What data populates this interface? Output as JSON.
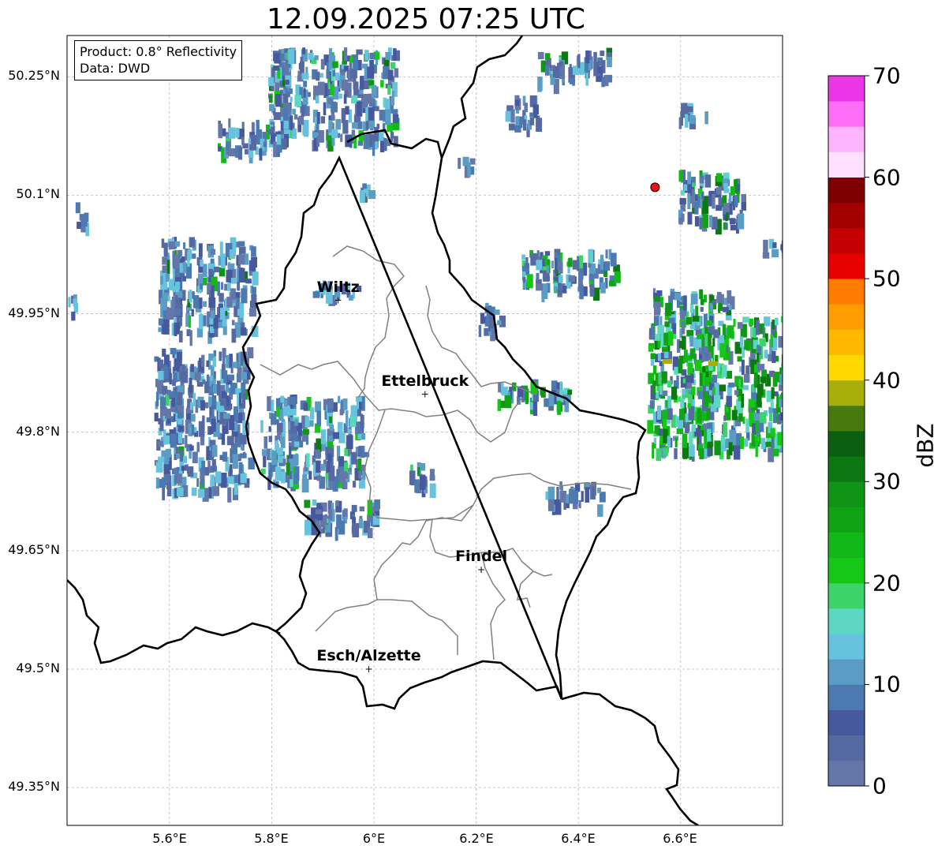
{
  "title": "12.09.2025 07:25 UTC",
  "info_box": {
    "product": "Product: 0.8° Reflectivity",
    "data": "Data: DWD"
  },
  "latitude_ticks": [
    "50.25°N",
    "50.1°N",
    "49.95°N",
    "49.8°N",
    "49.65°N",
    "49.5°N",
    "49.35°N"
  ],
  "longitude_ticks": [
    "5.6°E",
    "5.8°E",
    "6°E",
    "6.2°E",
    "6.4°E",
    "6.6°E"
  ],
  "cities": [
    {
      "name": "Wiltz",
      "lon": 5.93,
      "lat": 49.967
    },
    {
      "name": "Ettelbruck",
      "lon": 6.1,
      "lat": 49.848
    },
    {
      "name": "Findel",
      "lon": 6.21,
      "lat": 49.626
    },
    {
      "name": "Esch/Alzette",
      "lon": 5.99,
      "lat": 49.5
    }
  ],
  "marker": {
    "lon": 6.55,
    "lat": 50.11,
    "color": "#ee1111"
  },
  "colorbar": {
    "label": "dBZ",
    "ticks": [
      "0",
      "10",
      "20",
      "30",
      "40",
      "50",
      "60",
      "70"
    ],
    "colors": [
      "#6477a8",
      "#5669a0",
      "#46599e",
      "#4b79b0",
      "#5a9cc4",
      "#66c2dd",
      "#5dd6c4",
      "#3cd46a",
      "#15c815",
      "#12b818",
      "#10a414",
      "#0f9416",
      "#0c7812",
      "#0a6010",
      "#467a0e",
      "#a8ae0a",
      "#ffd800",
      "#ffb800",
      "#ff9c00",
      "#ff7c00",
      "#e60000",
      "#c40000",
      "#a40000",
      "#7e0000",
      "#ffe0ff",
      "#ffb4ff",
      "#ff6ef6",
      "#ea36e6"
    ]
  }
}
